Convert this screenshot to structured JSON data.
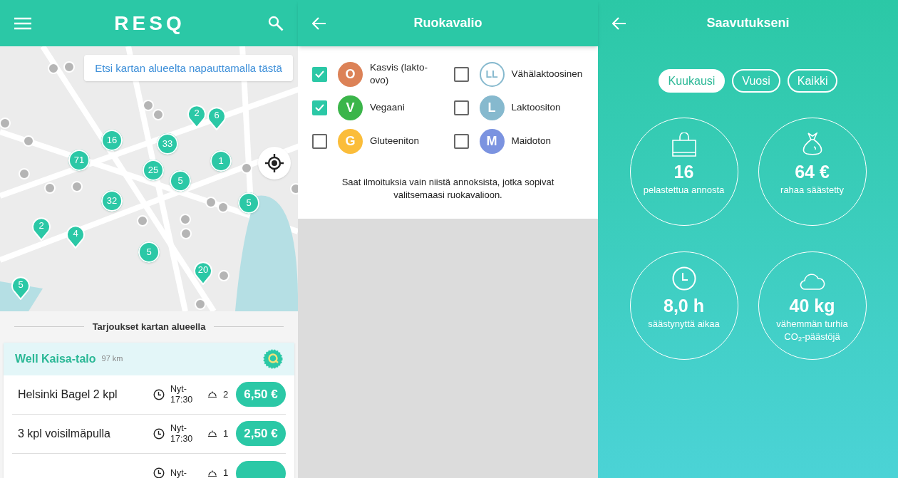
{
  "map_screen": {
    "logo": "RESQ",
    "search_hint": "Etsi kartan alueelta napauttamalla tästä",
    "markers": [
      {
        "label": "16",
        "kind": "cluster"
      },
      {
        "label": "33",
        "kind": "cluster"
      },
      {
        "label": "71",
        "kind": "cluster"
      },
      {
        "label": "25",
        "kind": "cluster"
      },
      {
        "label": "5",
        "kind": "cluster"
      },
      {
        "label": "1",
        "kind": "cluster"
      },
      {
        "label": "32",
        "kind": "cluster"
      },
      {
        "label": "5",
        "kind": "cluster"
      },
      {
        "label": "5",
        "kind": "cluster"
      },
      {
        "label": "2",
        "kind": "pin"
      },
      {
        "label": "2",
        "kind": "pin"
      },
      {
        "label": "6",
        "kind": "pin"
      },
      {
        "label": "4",
        "kind": "pin"
      },
      {
        "label": "20",
        "kind": "pin"
      },
      {
        "label": "5",
        "kind": "pin"
      }
    ],
    "section_title": "Tarjoukset kartan alueella",
    "store": {
      "name": "Well Kaisa-talo",
      "distance": "97 km"
    },
    "offers": [
      {
        "name": "Helsinki Bagel 2 kpl",
        "time": "Nyt-\n17:30",
        "count": "2",
        "price": "6,50 €"
      },
      {
        "name": "3 kpl voisilmäpulla",
        "time": "Nyt-\n17:30",
        "count": "1",
        "price": "2,50 €"
      },
      {
        "time": "Nyt-",
        "count": "1"
      }
    ]
  },
  "diet_screen": {
    "title": "Ruokavalio",
    "options": [
      {
        "letter": "O",
        "label": "Kasvis (lakto-ovo)",
        "color": "#dc8257",
        "outlined": false,
        "checked": true
      },
      {
        "letter": "LL",
        "label": "Vähälaktoosinen",
        "color": "#86b9ce",
        "outlined": true,
        "checked": false
      },
      {
        "letter": "V",
        "label": "Vegaani",
        "color": "#3bb54a",
        "outlined": false,
        "checked": true
      },
      {
        "letter": "L",
        "label": "Laktoositon",
        "color": "#86b9ce",
        "outlined": false,
        "checked": false
      },
      {
        "letter": "G",
        "label": "Gluteeniton",
        "color": "#fbbd3a",
        "outlined": false,
        "checked": false
      },
      {
        "letter": "M",
        "label": "Maidoton",
        "color": "#7b93e0",
        "outlined": false,
        "checked": false
      }
    ],
    "note": "Saat ilmoituksia vain niistä annoksista, jotka sopivat valitsemaasi ruokavalioon."
  },
  "achievements_screen": {
    "title": "Saavutukseni",
    "tabs": [
      {
        "label": "Kuukausi",
        "selected": true
      },
      {
        "label": "Vuosi",
        "selected": false
      },
      {
        "label": "Kaikki",
        "selected": false
      }
    ],
    "stats": [
      {
        "kind": "bag",
        "value": "16",
        "caption": "pelastettua annosta"
      },
      {
        "kind": "money",
        "value": "64 €",
        "caption": "rahaa säästetty"
      },
      {
        "kind": "clock",
        "value": "8,0 h",
        "caption": "säästynyttä aikaa"
      },
      {
        "kind": "cloud",
        "value": "40 kg",
        "caption": "vähemmän turhia CO$_{2}$-päästöjä"
      }
    ]
  }
}
